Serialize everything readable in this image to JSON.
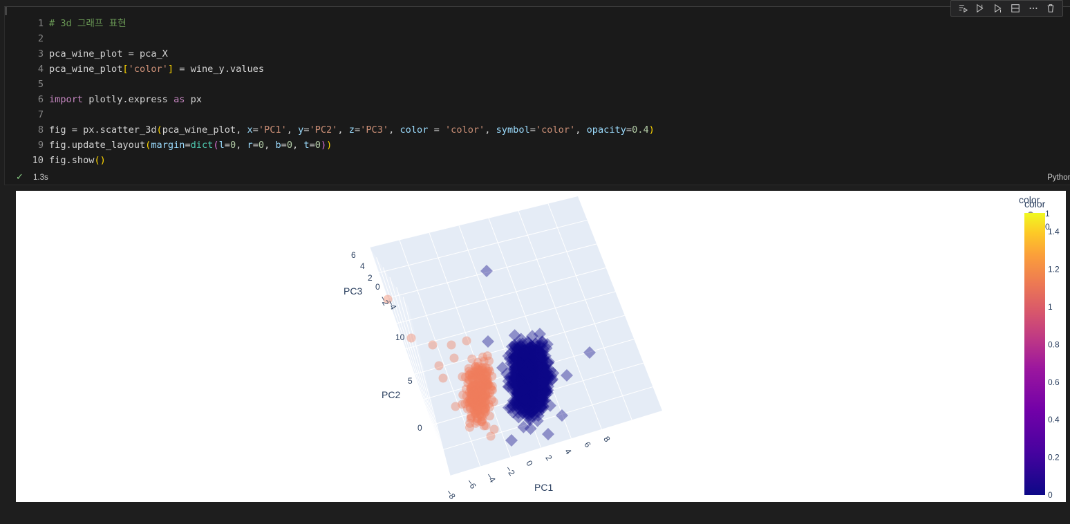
{
  "cell": {
    "line_numbers": [
      "1",
      "2",
      "3",
      "4",
      "5",
      "6",
      "7",
      "8",
      "9",
      "10"
    ],
    "code": {
      "l1": "# 3d 그래프 표현",
      "l3_a": "pca_wine_plot = pca_X",
      "l4_a": "pca_wine_plot",
      "l4_b": "[",
      "l4_c": "'color'",
      "l4_d": "]",
      "l4_e": " = wine_y.values",
      "l6_a": "import",
      "l6_b": " plotly.express ",
      "l6_c": "as",
      "l6_d": " px",
      "l8_a": "fig = px.scatter_3d",
      "l8_b": "(",
      "l8_c": "pca_wine_plot, ",
      "l8_d": "x",
      "l8_e": "=",
      "l8_f": "'PC1'",
      "l8_g": ", ",
      "l8_h": "y",
      "l8_i": "=",
      "l8_j": "'PC2'",
      "l8_k": ", ",
      "l8_l": "z",
      "l8_m": "=",
      "l8_n": "'PC3'",
      "l8_o": ", ",
      "l8_p": "color",
      "l8_q": " = ",
      "l8_r": "'color'",
      "l8_s": ", ",
      "l8_t": "symbol",
      "l8_u": "=",
      "l8_v": "'color'",
      "l8_w": ", ",
      "l8_x": "opacity",
      "l8_y": "=",
      "l8_z": "0.4",
      "l8_zz": ")",
      "l9_a": "fig.update_layout",
      "l9_b": "(",
      "l9_c": "margin",
      "l9_d": "=",
      "l9_e": "dict",
      "l9_f": "(",
      "l9_g": "l",
      "l9_h": "=",
      "l9_i": "0",
      "l9_j": ", ",
      "l9_k": "r",
      "l9_l": "=",
      "l9_m": "0",
      "l9_n": ", ",
      "l9_o": "b",
      "l9_p": "=",
      "l9_q": "0",
      "l9_r": ", ",
      "l9_s": "t",
      "l9_t": "=",
      "l9_u": "0",
      "l9_v": ")",
      "l9_w": ")",
      "l10_a": "fig.show",
      "l10_b": "()"
    },
    "status": {
      "exec_time": "1.3s",
      "kernel_language": "Python"
    },
    "toolbar_icons": [
      "run-by-line-icon",
      "execute-above-icon",
      "execute-below-icon",
      "split-cell-icon",
      "more-actions-icon",
      "delete-cell-icon"
    ]
  },
  "chart_data": {
    "type": "scatter",
    "projection": "3d",
    "x_axis": {
      "title": "PC1",
      "ticks": [
        "−8",
        "−6",
        "−4",
        "−2",
        "0",
        "2",
        "4",
        "6",
        "8"
      ]
    },
    "y_axis": {
      "title": "PC2",
      "ticks": [
        "0",
        "5",
        "10"
      ]
    },
    "z_axis": {
      "title": "PC3",
      "ticks": [
        "−4",
        "−2",
        "0",
        "2",
        "4",
        "6"
      ]
    },
    "series": [
      {
        "name": "0",
        "symbol": "diamond",
        "color": "#0d0887",
        "opacity": 0.4
      },
      {
        "name": "1",
        "symbol": "circle",
        "color": "#ef7c5c",
        "opacity": 0.4
      }
    ],
    "legend": {
      "title": "color",
      "entries": [
        "1",
        "0"
      ],
      "placement": "top-right"
    },
    "colorbar": {
      "title": "color",
      "ticks": [
        "0",
        "0.2",
        "0.4",
        "0.6",
        "0.8",
        "1",
        "1.2",
        "1.4"
      ],
      "range": [
        0,
        1.5
      ]
    },
    "colors": {
      "low": "#0d0887",
      "high": "#f0f921",
      "scene_bg": "#e5ecf6",
      "grid": "#ffffff",
      "text": "#2a3f5f"
    }
  }
}
